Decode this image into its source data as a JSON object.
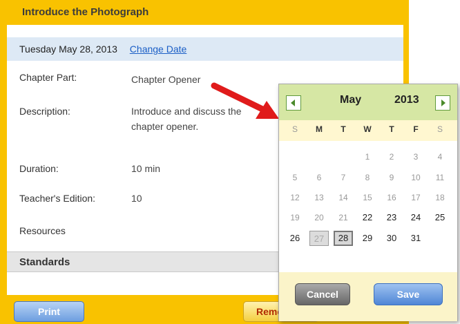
{
  "panel": {
    "title": "Introduce the Photograph",
    "date": "Tuesday May 28, 2013",
    "change_date_link": "Change Date",
    "fields": [
      {
        "label": "Chapter Part:",
        "value": "Chapter Opener"
      },
      {
        "label": "Description:",
        "value_line1": "Introduce and discuss the",
        "value_line2": "chapter opener."
      },
      {
        "label": "Duration:",
        "value": "10 min"
      },
      {
        "label": "Teacher's Edition:",
        "value": "10"
      },
      {
        "label": "Resources"
      }
    ],
    "standards_heading": "Standards",
    "print_button": "Print",
    "remove_button": "Remove"
  },
  "calendar": {
    "month": "May",
    "year": "2013",
    "prev_icon": "triangle-left-icon",
    "next_icon": "triangle-right-icon",
    "weekdays": [
      "S",
      "M",
      "T",
      "W",
      "T",
      "F",
      "S"
    ],
    "weeks": [
      [
        "",
        "",
        "",
        "1",
        "2",
        "3",
        "4"
      ],
      [
        "5",
        "6",
        "7",
        "8",
        "9",
        "10",
        "11"
      ],
      [
        "12",
        "13",
        "14",
        "15",
        "16",
        "17",
        "18"
      ],
      [
        "19",
        "20",
        "21",
        "22",
        "23",
        "24",
        "25"
      ],
      [
        "26",
        "27",
        "28",
        "29",
        "30",
        "31",
        ""
      ]
    ],
    "today": "27",
    "selected": "28",
    "cancel_button": "Cancel",
    "save_button": "Save"
  },
  "colors": {
    "frame": "#f9c200",
    "calendar_header": "#d6e7a4",
    "arrow": "#e01b1b"
  }
}
